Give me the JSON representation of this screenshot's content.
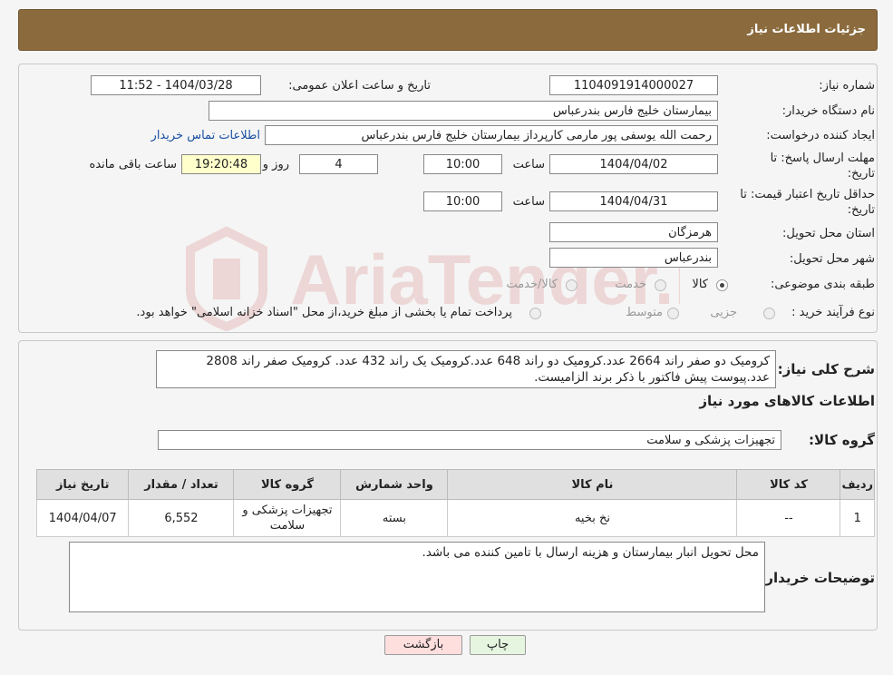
{
  "header": {
    "title": "جزئیات اطلاعات نیاز"
  },
  "form": {
    "need_number_label": "شماره نیاز:",
    "need_number": "1104091914000027",
    "announce_datetime_label": "تاریخ و ساعت اعلان عمومی:",
    "announce_datetime": "1404/03/28 - 11:52",
    "buyer_org_label": "نام دستگاه خریدار:",
    "buyer_org": "بیمارستان خلیج فارس بندرعباس",
    "requester_label": "ایجاد کننده درخواست:",
    "requester": "رحمت الله یوسفی پور مارمی کارپرداز بیمارستان خلیج فارس بندرعباس",
    "buyer_contact_link": "اطلاعات تماس خریدار",
    "reply_deadline_label_1": "مهلت ارسال پاسخ: تا",
    "reply_deadline_label_2": "تاریخ:",
    "reply_date": "1404/04/02",
    "time_label": "ساعت",
    "reply_time": "10:00",
    "days_value": "4",
    "days_label": "روز و",
    "remaining_time": "19:20:48",
    "remaining_label": "ساعت باقی مانده",
    "price_validity_label_1": "حداقل تاریخ اعتبار قیمت: تا",
    "price_validity_label_2": "تاریخ:",
    "price_validity_date": "1404/04/31",
    "price_validity_time": "10:00",
    "province_label": "استان محل تحویل:",
    "province": "هرمزگان",
    "city_label": "شهر محل تحویل:",
    "city": "بندرعباس",
    "category_label": "طبقه بندی موضوعی:",
    "category_options": [
      "کالا",
      "خدمت",
      "کالا/خدمت"
    ],
    "purchase_type_label": "نوع فرآیند خرید :",
    "purchase_type_options": [
      "جزیی",
      "متوسط"
    ],
    "purchase_note": "پرداخت تمام یا بخشی از مبلغ خرید،از محل \"اسناد خزانه اسلامی\" خواهد بود."
  },
  "description": {
    "label": "شرح کلی نیاز:",
    "text": "کرومیک دو صفر راند 2664 عدد.کرومیک دو راند 648 عدد.کرومیک یک راند 432 عدد. کرومیک صفر راند 2808 عدد.پیوست پیش فاکتور با ذکر برند الزامیست."
  },
  "goods": {
    "section_title": "اطلاعات کالاهای مورد نیاز",
    "group_label": "گروه کالا:",
    "group_value": "تجهیزات پزشکی و سلامت",
    "columns": [
      "ردیف",
      "کد کالا",
      "نام کالا",
      "واحد شمارش",
      "گروه کالا",
      "تعداد / مقدار",
      "تاریخ نیاز"
    ],
    "rows": [
      [
        "1",
        "--",
        "نخ بخیه",
        "بسته",
        "تجهیزات پزشکی و سلامت",
        "6,552",
        "1404/04/07"
      ]
    ]
  },
  "buyer_notes": {
    "label": "توضیحات خریدار:",
    "text": "محل تحویل انبار بیمارستان و هزینه ارسال با تامین کننده می باشد."
  },
  "buttons": {
    "print": "چاپ",
    "back": "بازگشت"
  },
  "colors": {
    "header_bg": "#8b6b3e",
    "link": "#1a4fa3",
    "back_btn": "#ffdede",
    "print_btn": "#e6f5e0"
  }
}
